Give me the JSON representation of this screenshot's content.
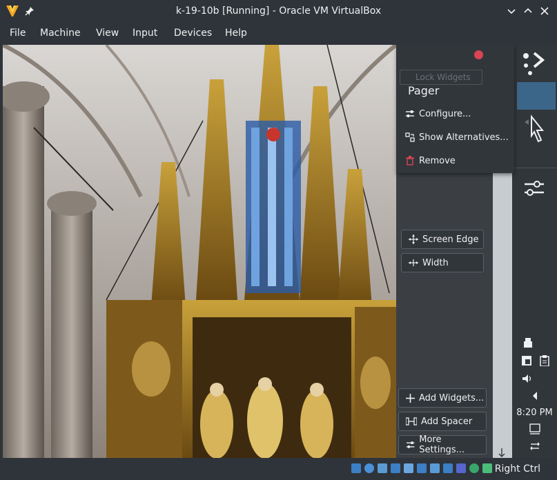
{
  "window": {
    "title": "k-19-10b [Running] - Oracle VM VirtualBox"
  },
  "menu": [
    {
      "label": "File"
    },
    {
      "label": "Machine"
    },
    {
      "label": "View"
    },
    {
      "label": "Input"
    },
    {
      "label": "Devices"
    },
    {
      "label": "Help"
    }
  ],
  "popup": {
    "ghost_label": "Lock Widgets",
    "title": "Pager",
    "items": [
      {
        "label": "Configure...",
        "icon": "configure-icon"
      },
      {
        "label": "Show Alternatives...",
        "icon": "alternatives-icon"
      },
      {
        "label": "Remove",
        "icon": "trash-icon"
      }
    ]
  },
  "panel_controls": {
    "screen_edge": "Screen Edge",
    "width": "Width",
    "add_widgets": "Add Widgets...",
    "add_spacer": "Add Spacer",
    "more_settings": "More Settings..."
  },
  "tray": {
    "clock": "8:20 PM"
  },
  "statusbar": {
    "host_key": "Right Ctrl"
  },
  "colors": {
    "chrome": "#2f343a",
    "accent": "#3daee9",
    "danger": "#da4453",
    "pager_box": "#3c6689"
  }
}
